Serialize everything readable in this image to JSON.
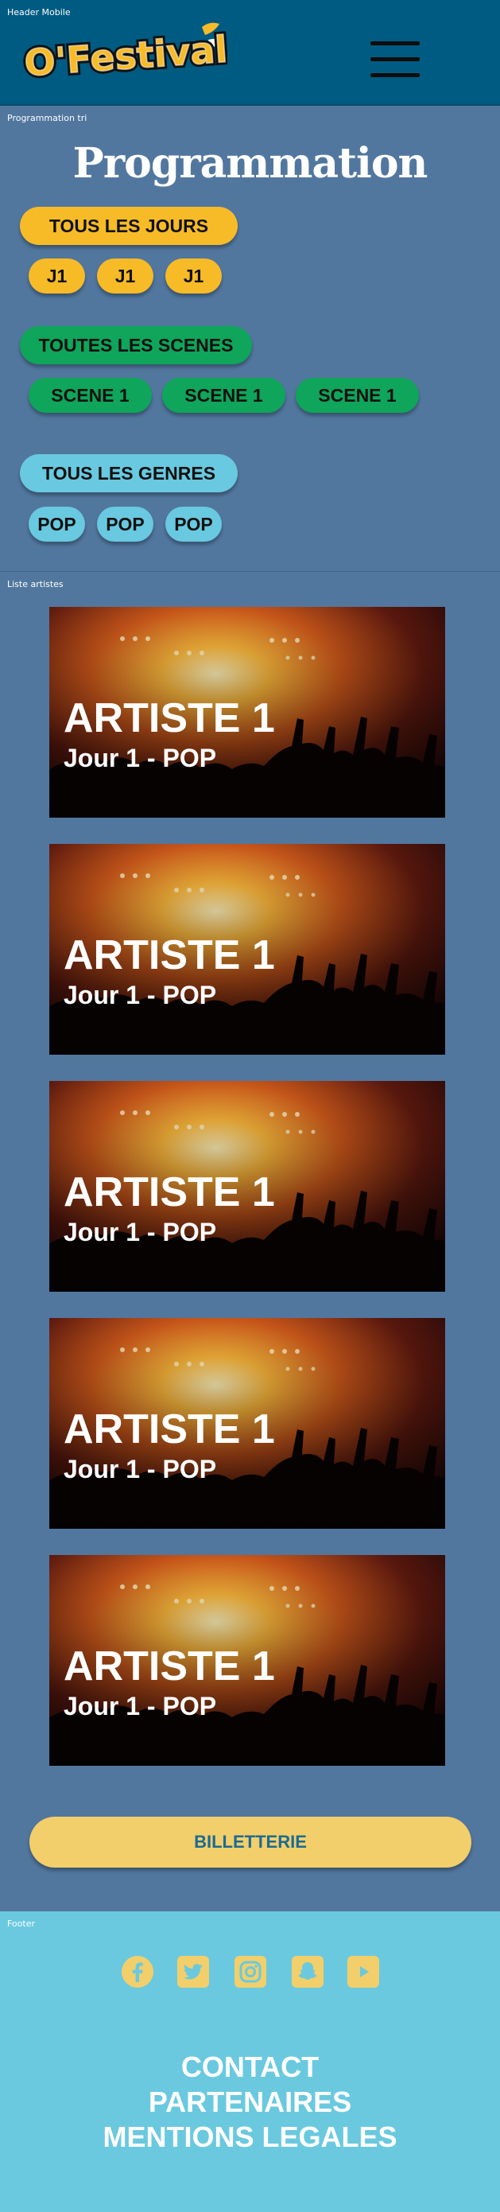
{
  "frame_labels": {
    "header": "Header Mobile",
    "programmation": "Programmation tri",
    "artists": "Liste artistes",
    "footer": "Footer"
  },
  "header": {
    "logo_text": "O'Festival"
  },
  "programmation": {
    "title": "Programmation",
    "days": {
      "all_label": "TOUS LES JOURS",
      "items": [
        "J1",
        "J1",
        "J1"
      ]
    },
    "scenes": {
      "all_label": "TOUTES LES SCENES",
      "items": [
        "SCENE 1",
        "SCENE 1",
        "SCENE 1"
      ]
    },
    "genres": {
      "all_label": "TOUS LES GENRES",
      "items": [
        "POP",
        "POP",
        "POP"
      ]
    }
  },
  "artists": [
    {
      "name": "ARTISTE 1",
      "subtitle": "Jour 1 - POP"
    },
    {
      "name": "ARTISTE 1",
      "subtitle": "Jour 1 - POP"
    },
    {
      "name": "ARTISTE 1",
      "subtitle": "Jour 1 - POP"
    },
    {
      "name": "ARTISTE 1",
      "subtitle": "Jour 1 - POP"
    },
    {
      "name": "ARTISTE 1",
      "subtitle": "Jour 1 - POP"
    }
  ],
  "billetterie_label": "BILLETTERIE",
  "footer": {
    "social_icons": [
      "facebook-icon",
      "twitter-icon",
      "instagram-icon",
      "snapchat-icon",
      "youtube-icon"
    ],
    "links": [
      "CONTACT",
      "PARTENAIRES",
      "MENTIONS LEGALES"
    ]
  },
  "colors": {
    "header_bg": "#005b82",
    "page_bg": "#52779f",
    "footer_bg": "#6ac9df",
    "accent_yellow": "#f7bb28",
    "accent_green": "#0fa55a",
    "accent_cyan": "#68c9e0",
    "billetterie_bg": "#f2cf6a",
    "billetterie_text": "#1d6a94"
  }
}
